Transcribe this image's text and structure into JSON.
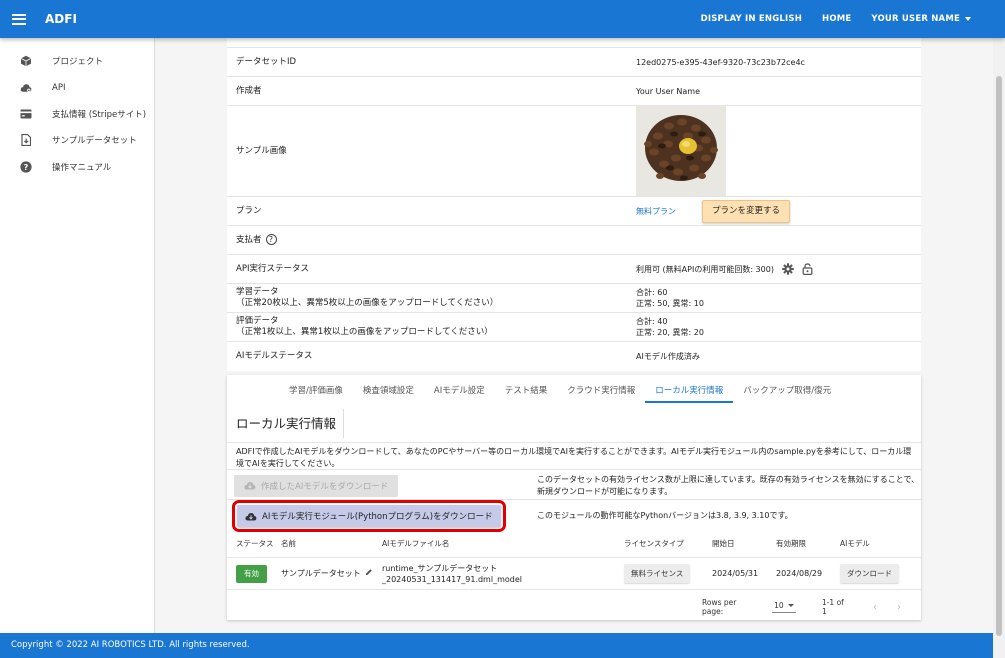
{
  "header": {
    "app_title": "ADFI",
    "lang_button": "DISPLAY IN ENGLISH",
    "home_button": "HOME",
    "user_button": "YOUR USER NAME"
  },
  "sidebar": {
    "items": [
      {
        "label": "プロジェクト",
        "icon": "cube-icon"
      },
      {
        "label": "API",
        "icon": "cloud-gear-icon"
      },
      {
        "label": "支払情報 (Stripeサイト)",
        "icon": "credit-card-icon"
      },
      {
        "label": "サンプルデータセット",
        "icon": "file-download-icon"
      },
      {
        "label": "操作マニュアル",
        "icon": "help-icon"
      }
    ]
  },
  "details": {
    "dataset_id_label": "データセットID",
    "dataset_id_value": "12ed0275-e395-43ef-9320-73c23b72ce4c",
    "creator_label": "作成者",
    "creator_value": "Your User Name",
    "sample_image_label": "サンプル画像",
    "plan_label": "プラン",
    "plan_value": "無料プラン",
    "change_plan_button": "プランを変更する",
    "payer_label": "支払者",
    "payer_help": "?",
    "api_status_label": "API実行ステータス",
    "api_status_value": "利用可 (無料APIの利用可能回数: 300)",
    "train_label": "学習データ",
    "train_sub": "（正常20枚以上、異常5枚以上の画像をアップロードしてください）",
    "train_total": "合計: 60",
    "train_split": "正常: 50, 異常: 10",
    "eval_label": "評価データ",
    "eval_sub": "（正常1枚以上、異常1枚以上の画像をアップロードしてください）",
    "eval_total": "合計: 40",
    "eval_split": "正常: 20, 異常: 20",
    "model_status_label": "AIモデルステータス",
    "model_status_value": "AIモデル作成済み"
  },
  "tabs": [
    {
      "label": "学習/評価画像",
      "active": false
    },
    {
      "label": "検査領域設定",
      "active": false
    },
    {
      "label": "AIモデル設定",
      "active": false
    },
    {
      "label": "テスト結果",
      "active": false
    },
    {
      "label": "クラウド実行情報",
      "active": false
    },
    {
      "label": "ローカル実行情報",
      "active": true
    },
    {
      "label": "バックアップ取得/復元",
      "active": false
    }
  ],
  "local": {
    "title": "ローカル実行情報",
    "description": "ADFIで作成したAIモデルをダウンロードして、あなたのPCやサーバー等のローカル環境でAIを実行することができます。AIモデル実行モジュール内のsample.pyを参考にして、ローカル環境でAIを実行してください。",
    "download_model_button": "作成したAIモデルをダウンロード",
    "download_model_note": "このデータセットの有効ライセンス数が上限に達しています。既存の有効ライセンスを無効にすることで、新規ダウンロードが可能になります。",
    "download_module_button": "AIモデル実行モジュール(Pythonプログラム)をダウンロード",
    "download_module_note": "このモジュールの動作可能なPythonバージョンは3.8, 3.9, 3.10です。"
  },
  "table": {
    "headers": [
      "ステータス",
      "名前",
      "AIモデルファイル名",
      "ライセンスタイプ",
      "開始日",
      "有効期限",
      "AIモデル"
    ],
    "rows": [
      {
        "status": "有効",
        "name": "サンプルデータセット",
        "file_line1": "runtime_サンプルデータセット",
        "file_line2": "_20240531_131417_91.dml_model",
        "license": "無料ライセンス",
        "start": "2024/05/31",
        "expiry": "2024/08/29",
        "action": "ダウンロード"
      }
    ]
  },
  "pager": {
    "rows_label": "Rows per page:",
    "rows_value": "10",
    "range": "1-1 of 1"
  },
  "footer": {
    "copyright": "Copyright © 2022 AI ROBOTICS LTD. All rights reserved."
  },
  "colors": {
    "primary": "#1976d2",
    "amber_button": "#ffe0b2",
    "status_green": "#43a047",
    "highlight_red": "#e00000"
  }
}
